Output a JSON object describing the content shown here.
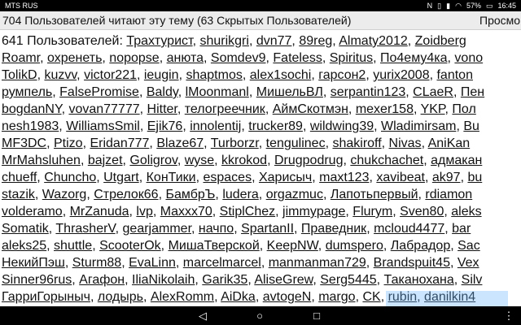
{
  "status": {
    "carrier": "MTS RUS",
    "icons": [
      "nfc-icon",
      "vibrate-icon",
      "signal-icon",
      "wifi-icon"
    ],
    "battery_percent": "57%",
    "time": "16:45"
  },
  "header": {
    "title": "704 Пользователей читают эту тему (63 Скрытых Пользователей)",
    "view_label": "Просмо"
  },
  "users": {
    "count_label": "641 Пользователей:",
    "lines": [
      [
        "Трахтурист",
        "shurikgri",
        "dvn77",
        "89reg",
        "Almaty2012",
        "Zoidberg"
      ],
      [
        "Roamr",
        "охренеть",
        "nopopse",
        "анюта",
        "Somdev9",
        "Fateless",
        "Spiritus",
        "По4ему4ка",
        "vono"
      ],
      [
        "TolikD",
        "kuzvv",
        "victor221",
        "ieugin",
        "shaptmos",
        "alex1sochi",
        "гарсон2",
        "yurix2008",
        "fanton"
      ],
      [
        "румпель",
        "FalsePromise",
        "Baldy",
        "lMoonmanl",
        "МишельВЛ",
        "serpantin123",
        "CLaeR",
        "Пен"
      ],
      [
        "bogdanNY",
        "vovan77777",
        "Hitter",
        "телогреечник",
        "АймСкотмэн",
        "mexer158",
        "YKP",
        "Пол"
      ],
      [
        "nesh1983",
        "WilliamsSmil",
        "Ejik76",
        "innolentij",
        "trucker89",
        "wildwing39",
        "Wladimirsam",
        "Bu"
      ],
      [
        "MF3DC",
        "Ptizo",
        "Eridan777",
        "Blaze67",
        "Turborzr",
        "tengulinec",
        "shakiroff",
        "Nivas",
        "AniKan"
      ],
      [
        "MrMahsluhen",
        "bajzet",
        "Goligrov",
        "wyse",
        "kkrokod",
        "Drugpodrug",
        "chukchachet",
        "адмакан"
      ],
      [
        "chueff",
        "Chuncho",
        "Utgart",
        "КонТики",
        "espaces",
        "Харисыч",
        "maxt123",
        "xavibeat",
        "ak97",
        "bu"
      ],
      [
        "stazik",
        "Wazorg",
        "Стрелок66",
        "БамбрЪ",
        "ludera",
        "orgazmuc",
        "Лапотьпервый",
        "rdiamon"
      ],
      [
        "volderamo",
        "MrZanuda",
        "lvp",
        "Maxxx70",
        "StiplChez",
        "jimmypage",
        "Flurym",
        "Sven80",
        "aleks"
      ],
      [
        "Somatik",
        "ThrasherV",
        "gearjammer",
        "начпо",
        "SpartanII",
        "Праведник",
        "mcloud4477",
        "bar"
      ],
      [
        "aleks25",
        "shuttle",
        "ScooterOk",
        "МишаТверской",
        "KeepNW",
        "dumspero",
        "Лабрадор",
        "Sac"
      ],
      [
        "НекийПэш",
        "Sturm88",
        "EvaLinn",
        "marcelmarcel",
        "manmanman729",
        "Brandspuit45",
        "Vex"
      ],
      [
        "Sinner96rus",
        "Агафон",
        "IliaNikolaih",
        "Garik35",
        "AliseGrew",
        "Serg5445",
        "Таканохана",
        "Silv"
      ],
      [
        "ГарриГорыныч",
        "лодырь",
        "AlexRomm",
        "AiDka",
        "avtogeN",
        "margo",
        "CK",
        "rubin",
        "danilkin4"
      ]
    ]
  },
  "nav": {
    "back": "◁",
    "home": "○",
    "recent": "□",
    "menu": "⋮"
  }
}
